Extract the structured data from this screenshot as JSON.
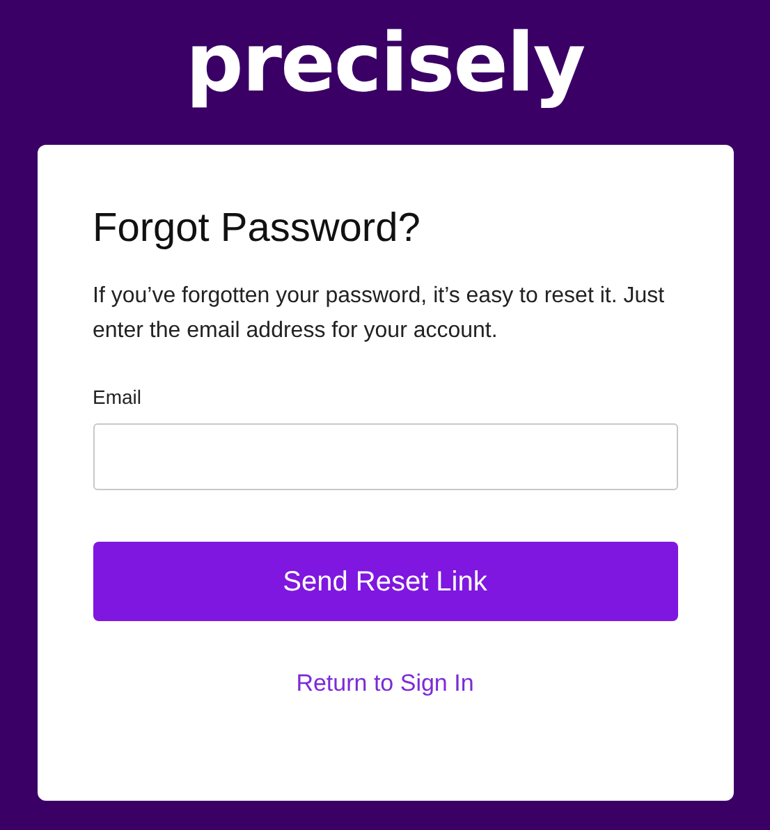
{
  "logo": {
    "text": "precisely"
  },
  "card": {
    "title": "Forgot Password?",
    "description": "If you’ve forgotten your password, it’s easy to reset it. Just enter the email address for your account.",
    "email_field": {
      "label": "Email"
    },
    "submit_button": {
      "label": "Send Reset Link"
    },
    "link": {
      "label": "Return to Sign In"
    }
  }
}
